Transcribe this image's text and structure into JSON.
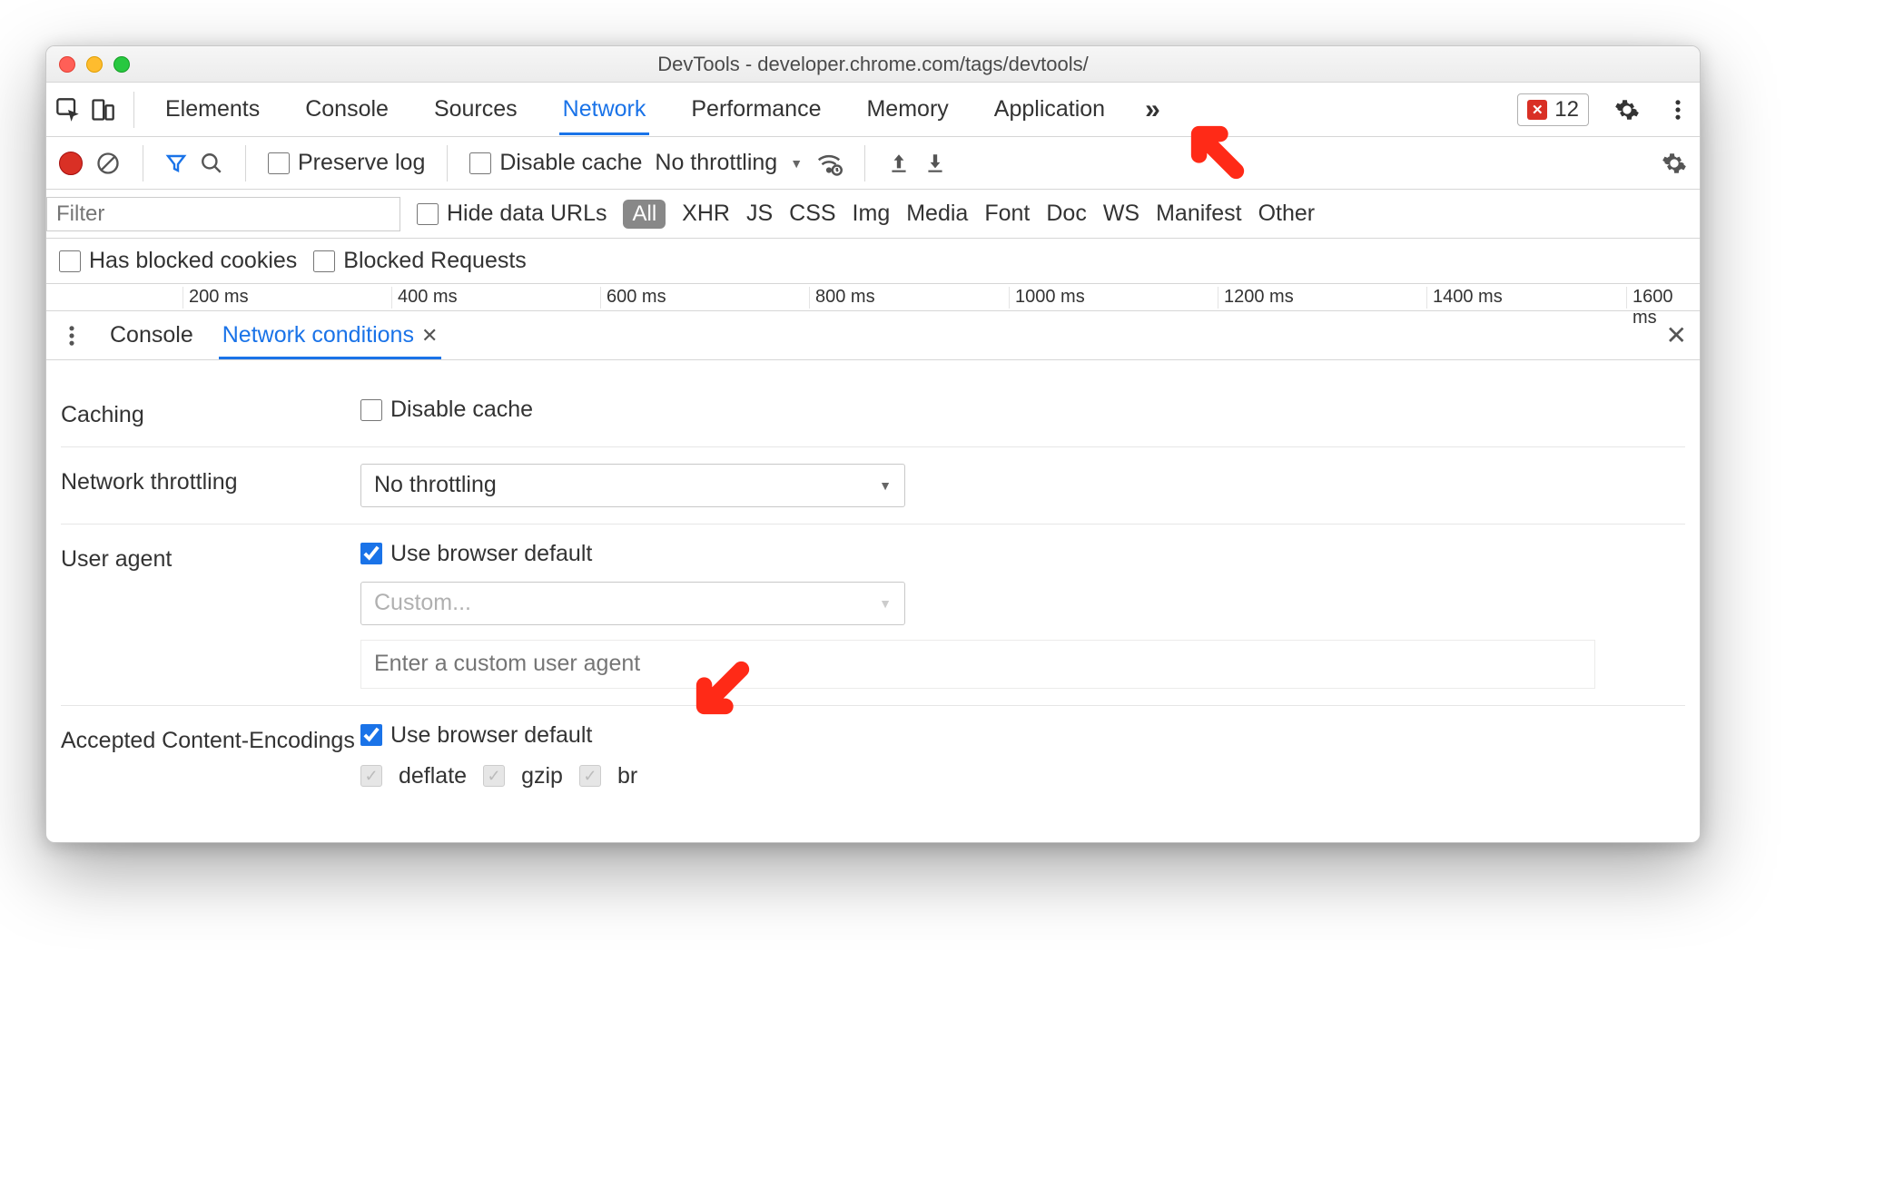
{
  "window": {
    "title": "DevTools - developer.chrome.com/tags/devtools/"
  },
  "tabs": [
    "Elements",
    "Console",
    "Sources",
    "Network",
    "Performance",
    "Memory",
    "Application"
  ],
  "active_tab": "Network",
  "errors": {
    "count": "12"
  },
  "network_toolbar": {
    "preserve_log": "Preserve log",
    "disable_cache": "Disable cache",
    "throttling": "No throttling"
  },
  "filterbar": {
    "placeholder": "Filter",
    "hide_data_urls": "Hide data URLs",
    "all_pill": "All",
    "types": [
      "XHR",
      "JS",
      "CSS",
      "Img",
      "Media",
      "Font",
      "Doc",
      "WS",
      "Manifest",
      "Other"
    ]
  },
  "cookiesbar": {
    "has_blocked": "Has blocked cookies",
    "blocked_requests": "Blocked Requests"
  },
  "waterfall_ticks": [
    "200 ms",
    "400 ms",
    "600 ms",
    "800 ms",
    "1000 ms",
    "1200 ms",
    "1400 ms",
    "1600 ms"
  ],
  "drawer_tabs": [
    "Console",
    "Network conditions"
  ],
  "drawer": {
    "caching": {
      "label": "Caching",
      "disable_cache": "Disable cache"
    },
    "throttling": {
      "label": "Network throttling",
      "value": "No throttling"
    },
    "user_agent": {
      "label": "User agent",
      "use_default": "Use browser default",
      "custom_select": "Custom...",
      "custom_placeholder": "Enter a custom user agent"
    },
    "encodings": {
      "label": "Accepted Content-Encodings",
      "use_default": "Use browser default",
      "items": [
        "deflate",
        "gzip",
        "br"
      ]
    }
  }
}
